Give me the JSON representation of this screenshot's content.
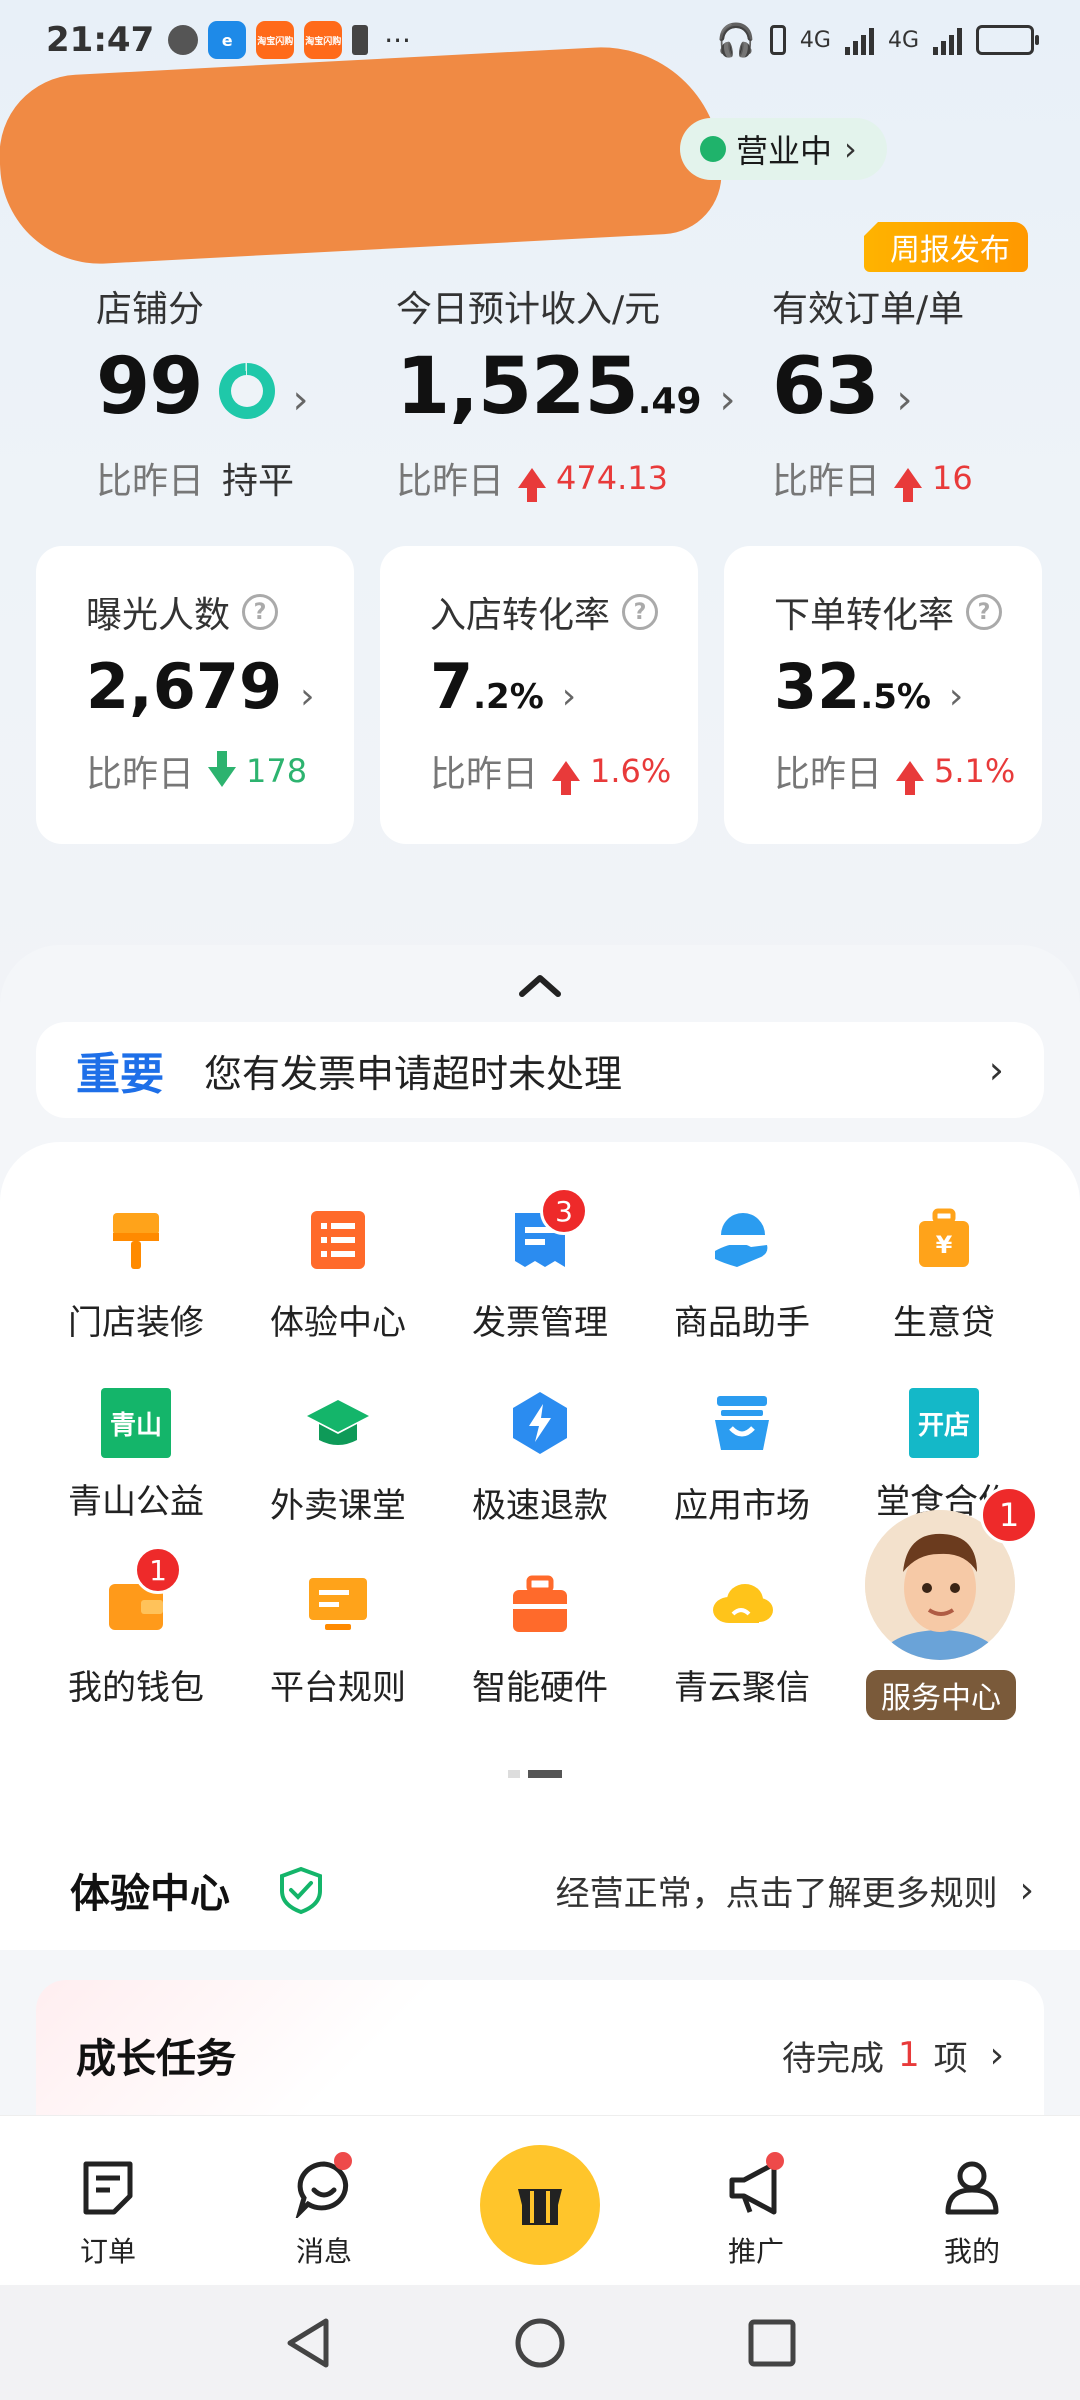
{
  "status_bar": {
    "time": "21:47",
    "apps": [
      "e",
      "淘宝闪购",
      "淘宝闪购"
    ],
    "more": "···",
    "net1": "4G",
    "net2": "4G"
  },
  "store": {
    "status": "营业中",
    "weekly_badge": "周报发布"
  },
  "stats": {
    "score": {
      "label": "店铺分",
      "value": "99",
      "compare_label": "比昨日",
      "compare_value": "持平"
    },
    "income": {
      "label": "今日预计收入/元",
      "value_int": "1,525",
      "value_dec": ".49",
      "compare_label": "比昨日",
      "delta": "474.13"
    },
    "orders": {
      "label": "有效订单/单",
      "value": "63",
      "compare_label": "比昨日",
      "delta": "16"
    }
  },
  "cards": [
    {
      "label": "曝光人数",
      "value": "2,679",
      "suffix": "",
      "compare_label": "比昨日",
      "delta": "178",
      "direction": "down"
    },
    {
      "label": "入店转化率",
      "value": "7",
      "suffix": ".2%",
      "compare_label": "比昨日",
      "delta": "1.6%",
      "direction": "up"
    },
    {
      "label": "下单转化率",
      "value": "32",
      "suffix": ".5%",
      "compare_label": "比昨日",
      "delta": "5.1%",
      "direction": "up"
    }
  ],
  "notice": {
    "tag": "重要",
    "text": "您有发票申请超时未处理"
  },
  "tools": [
    {
      "label": "门店装修",
      "icon": "paint-brush-icon"
    },
    {
      "label": "体验中心",
      "icon": "list-doc-icon"
    },
    {
      "label": "发票管理",
      "icon": "invoice-icon",
      "badge": "3"
    },
    {
      "label": "商品助手",
      "icon": "hand-helper-icon"
    },
    {
      "label": "生意贷",
      "icon": "loan-bag-icon"
    },
    {
      "label": "青山公益",
      "icon": "qingshan-icon",
      "icon_text": "青山"
    },
    {
      "label": "外卖课堂",
      "icon": "graduation-cap-icon"
    },
    {
      "label": "极速退款",
      "icon": "lightning-icon"
    },
    {
      "label": "应用市场",
      "icon": "shopping-basket-icon"
    },
    {
      "label": "堂食合作",
      "icon": "open-store-icon",
      "icon_text": "开店"
    },
    {
      "label": "我的钱包",
      "icon": "wallet-icon",
      "badge": "1"
    },
    {
      "label": "平台规则",
      "icon": "monitor-icon"
    },
    {
      "label": "智能硬件",
      "icon": "toolbox-icon"
    },
    {
      "label": "青云聚信",
      "icon": "cloud-icon"
    }
  ],
  "service_center": {
    "label": "服务中心",
    "badge": "1"
  },
  "experience": {
    "title": "体验中心",
    "text": "经营正常，点击了解更多规则"
  },
  "growth": {
    "title": "成长任务",
    "pending_prefix": "待完成",
    "pending_count": "1",
    "pending_suffix": "项"
  },
  "tabs": [
    {
      "label": "订单",
      "icon": "order-icon"
    },
    {
      "label": "消息",
      "icon": "message-icon",
      "dot": true
    },
    {
      "label": "",
      "icon": "store-center-icon"
    },
    {
      "label": "推广",
      "icon": "megaphone-icon",
      "dot": true
    },
    {
      "label": "我的",
      "icon": "profile-icon"
    }
  ],
  "colors": {
    "accent_blue": "#1e6fe8",
    "up_red": "#e83a3a",
    "down_green": "#2db36f",
    "center_yellow": "#ffc52b",
    "open_green": "#1fb36b"
  }
}
